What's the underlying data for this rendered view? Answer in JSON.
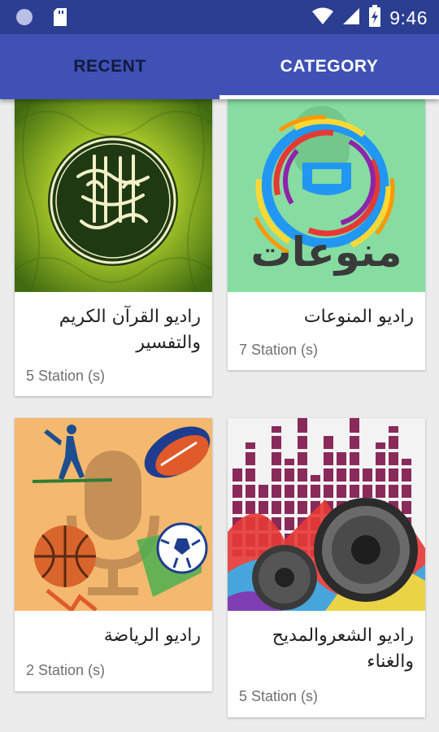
{
  "status_bar": {
    "time": "9:46",
    "icons": [
      "circle-notification-icon",
      "sd-card-icon",
      "wifi-icon",
      "cell-signal-icon",
      "battery-charging-icon"
    ]
  },
  "tabs": [
    {
      "label": "RECENT",
      "selected": false
    },
    {
      "label": "CATEGORY",
      "selected": true
    }
  ],
  "colors": {
    "status_bar": "#2c3e91",
    "app_bar": "#3f51b5",
    "indicator": "#ffffff",
    "background": "#ececec"
  },
  "categories": [
    {
      "title": "راديو القرآن الكريم والتفسير",
      "count": "5 Station (s)",
      "image": "quran-image"
    },
    {
      "title": "راديو المنوعات",
      "count": "7 Station (s)",
      "image": "variety-logo-image",
      "image_text": "منوعات"
    },
    {
      "title": "راديو الرياضة",
      "count": "2 Station (s)",
      "image": "sports-image"
    },
    {
      "title": "راديو الشعروالمديح والغناء",
      "count": "5 Station (s)",
      "image": "music-speakers-image"
    }
  ]
}
